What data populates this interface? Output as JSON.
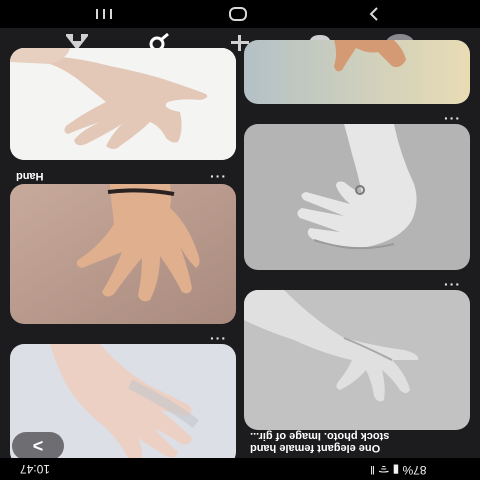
{
  "system_nav": {
    "recents_icon": "recents-icon",
    "home_icon": "home-circle-icon",
    "back_icon": "back-chevron-icon"
  },
  "app_bar": {
    "tabs": [
      {
        "name": "home",
        "icon": "home-icon"
      },
      {
        "name": "search",
        "icon": "search-icon"
      },
      {
        "name": "create",
        "icon": "plus-icon"
      },
      {
        "name": "notifications",
        "icon": "chat-bubble-icon",
        "badge_color": "#e60023"
      },
      {
        "name": "profile",
        "icon": "avatar-icon"
      }
    ]
  },
  "pins": {
    "left": [
      {
        "caption": "Hand",
        "more": "···"
      },
      {
        "caption": "",
        "more": "···"
      },
      {
        "caption": "",
        "more": ""
      }
    ],
    "right": [
      {
        "caption": "",
        "more": "···"
      },
      {
        "caption": "",
        "more": "···"
      },
      {
        "caption": "One elegant female hand stock photo. Image of gir...",
        "caption_line1": "One elegant female hand",
        "caption_line2": "stock photo. Image of gir...",
        "more": ""
      }
    ]
  },
  "status_bar": {
    "time": "10:47",
    "right_text": "87% ▮ ᯤ ǁ",
    "battery": "87%"
  },
  "back_fab": {
    "label": "<"
  },
  "colors": {
    "background": "#1c1c1e",
    "bar": "#000000",
    "badge": "#e60023"
  }
}
